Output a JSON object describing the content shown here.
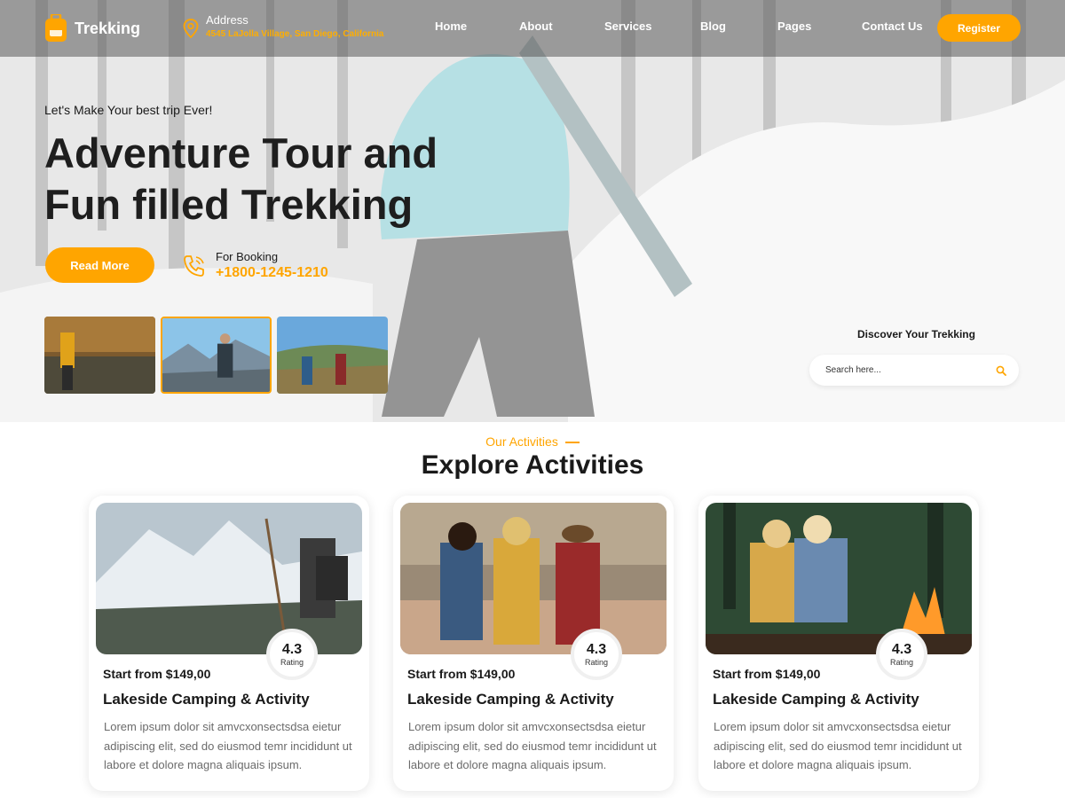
{
  "header": {
    "logo_text": "Trekking",
    "address_label": "Address",
    "address_value": "4545 LaJolla Village, San Diego, California",
    "menu": [
      "Home",
      "About",
      "Services",
      "Blog",
      "Pages",
      "Contact Us"
    ],
    "register_label": "Register"
  },
  "hero": {
    "tagline": "Let's Make Your best trip Ever!",
    "headline_line1": "Adventure Tour and",
    "headline_line2": "Fun filled Trekking",
    "read_more_label": "Read More",
    "booking_label": "For Booking",
    "booking_phone": "+1800-1245-1210",
    "discover_label": "Discover Your Trekking",
    "search_placeholder": "Search here..."
  },
  "activities": {
    "eyebrow": "Our Activities",
    "title": "Explore Activities",
    "cards": [
      {
        "price": "Start from $149,00",
        "title": "Lakeside Camping & Activity",
        "rating": "4.3",
        "rating_label": "Rating",
        "description": "Lorem ipsum dolor sit amvcxonsectsdsa eietur adipiscing elit, sed do eiusmod temr incididunt ut labore et dolore magna aliquais ipsum."
      },
      {
        "price": "Start from $149,00",
        "title": "Lakeside Camping & Activity",
        "rating": "4.3",
        "rating_label": "Rating",
        "description": "Lorem ipsum dolor sit amvcxonsectsdsa eietur adipiscing elit, sed do eiusmod temr incididunt ut labore et dolore magna aliquais ipsum."
      },
      {
        "price": "Start from $149,00",
        "title": "Lakeside Camping & Activity",
        "rating": "4.3",
        "rating_label": "Rating",
        "description": "Lorem ipsum dolor sit amvcxonsectsdsa eietur adipiscing elit, sed do eiusmod temr incididunt ut labore et dolore magna aliquais ipsum."
      }
    ]
  },
  "colors": {
    "accent": "#ffa500",
    "nav_overlay": "#5a5a5a"
  },
  "icons": [
    "backpack-logo-icon",
    "location-pin-icon",
    "phone-icon",
    "search-icon"
  ]
}
